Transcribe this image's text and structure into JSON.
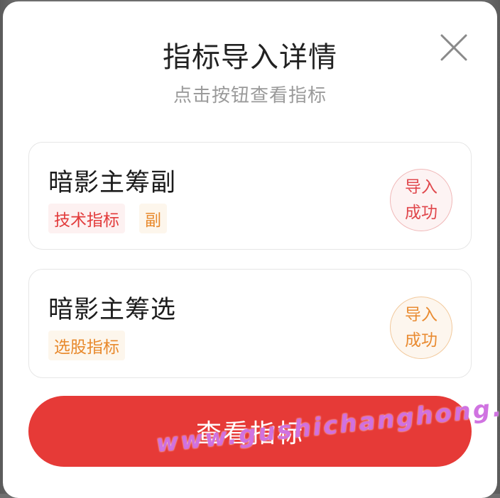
{
  "dialog": {
    "title": "指标导入详情",
    "subtitle": "点击按钮查看指标",
    "close_icon": "close-icon"
  },
  "cards": [
    {
      "name": "暗影主筹副",
      "tags": [
        "技术指标",
        "副"
      ],
      "status_line1": "导入",
      "status_line2": "成功",
      "status_color": "#e0474c"
    },
    {
      "name": "暗影主筹选",
      "tags": [
        "选股指标"
      ],
      "status_line1": "导入",
      "status_line2": "成功",
      "status_color": "#e98b31"
    }
  ],
  "cta": {
    "label": "查看指标",
    "color": "#e63a37"
  },
  "watermark": "www.gushichanghong.com"
}
